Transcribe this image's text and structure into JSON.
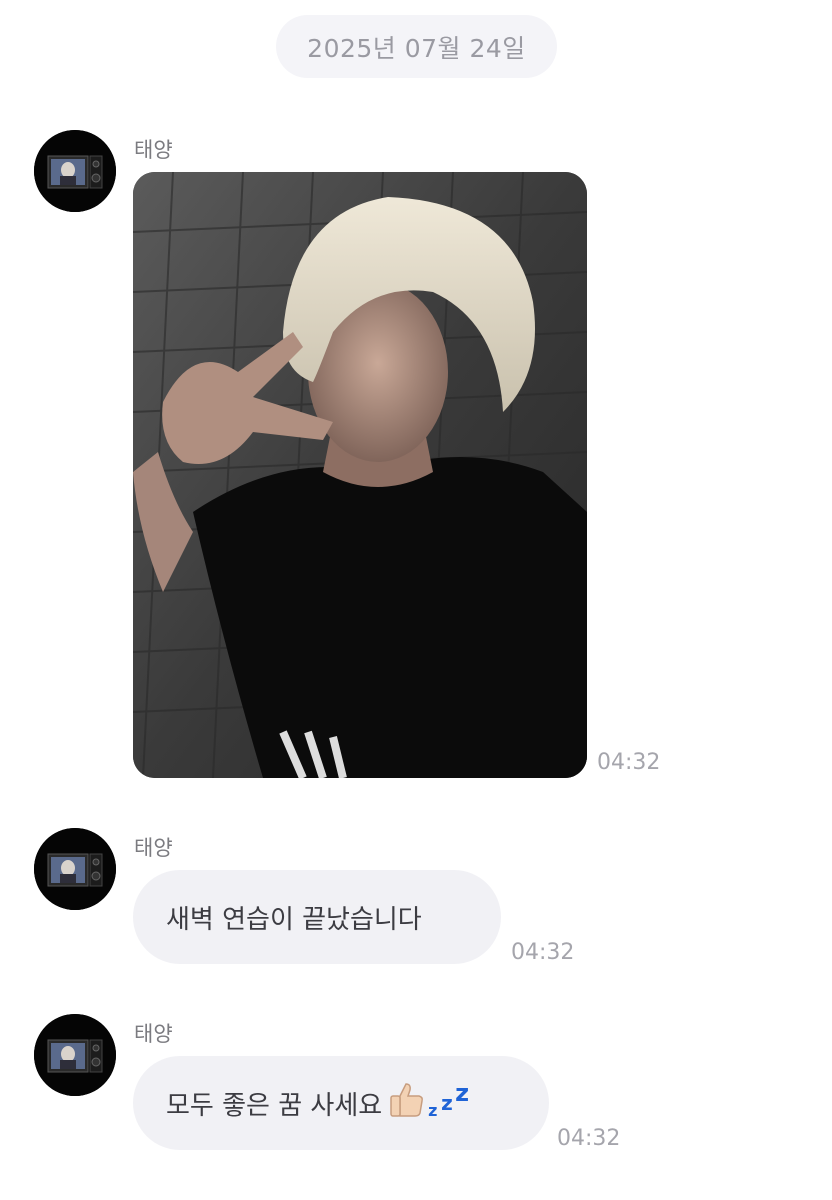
{
  "date_divider": "2025년 07월 24일",
  "messages": [
    {
      "sender": "태양",
      "type": "photo",
      "time": "04:32",
      "avatar_icon": "profile-avatar"
    },
    {
      "sender": "태양",
      "type": "text",
      "text": "새벽 연습이 끝났습니다",
      "time": "04:32",
      "avatar_icon": "profile-avatar"
    },
    {
      "sender": "태양",
      "type": "text",
      "text": "모두 좋은 꿈 사세요",
      "emoji": [
        "thumbs-up-icon",
        "zzz-icon"
      ],
      "time": "04:32",
      "avatar_icon": "profile-avatar"
    }
  ],
  "colors": {
    "bubble_bg": "#f1f1f5",
    "date_pill_bg": "#f4f4f8",
    "timestamp": "#a5a5ac",
    "sender_name": "#7b7b80",
    "zzz_blue": "#1f63d6"
  }
}
